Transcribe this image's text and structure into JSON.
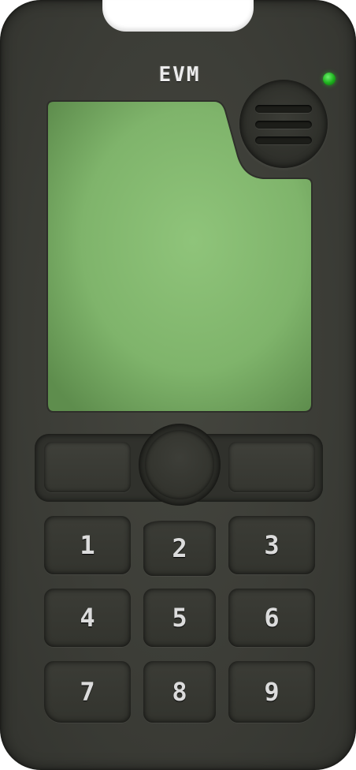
{
  "phone": {
    "brand": "EVM",
    "status_led_color": "#1cb01c",
    "screen_color": "#8fc47a",
    "speaker_icon": "speaker-grille-icon"
  },
  "keypad": {
    "keys": [
      "1",
      "2",
      "3",
      "4",
      "5",
      "6",
      "7",
      "8",
      "9"
    ]
  },
  "navigation": {
    "left_softkey": "",
    "right_softkey": "",
    "select_key": ""
  }
}
